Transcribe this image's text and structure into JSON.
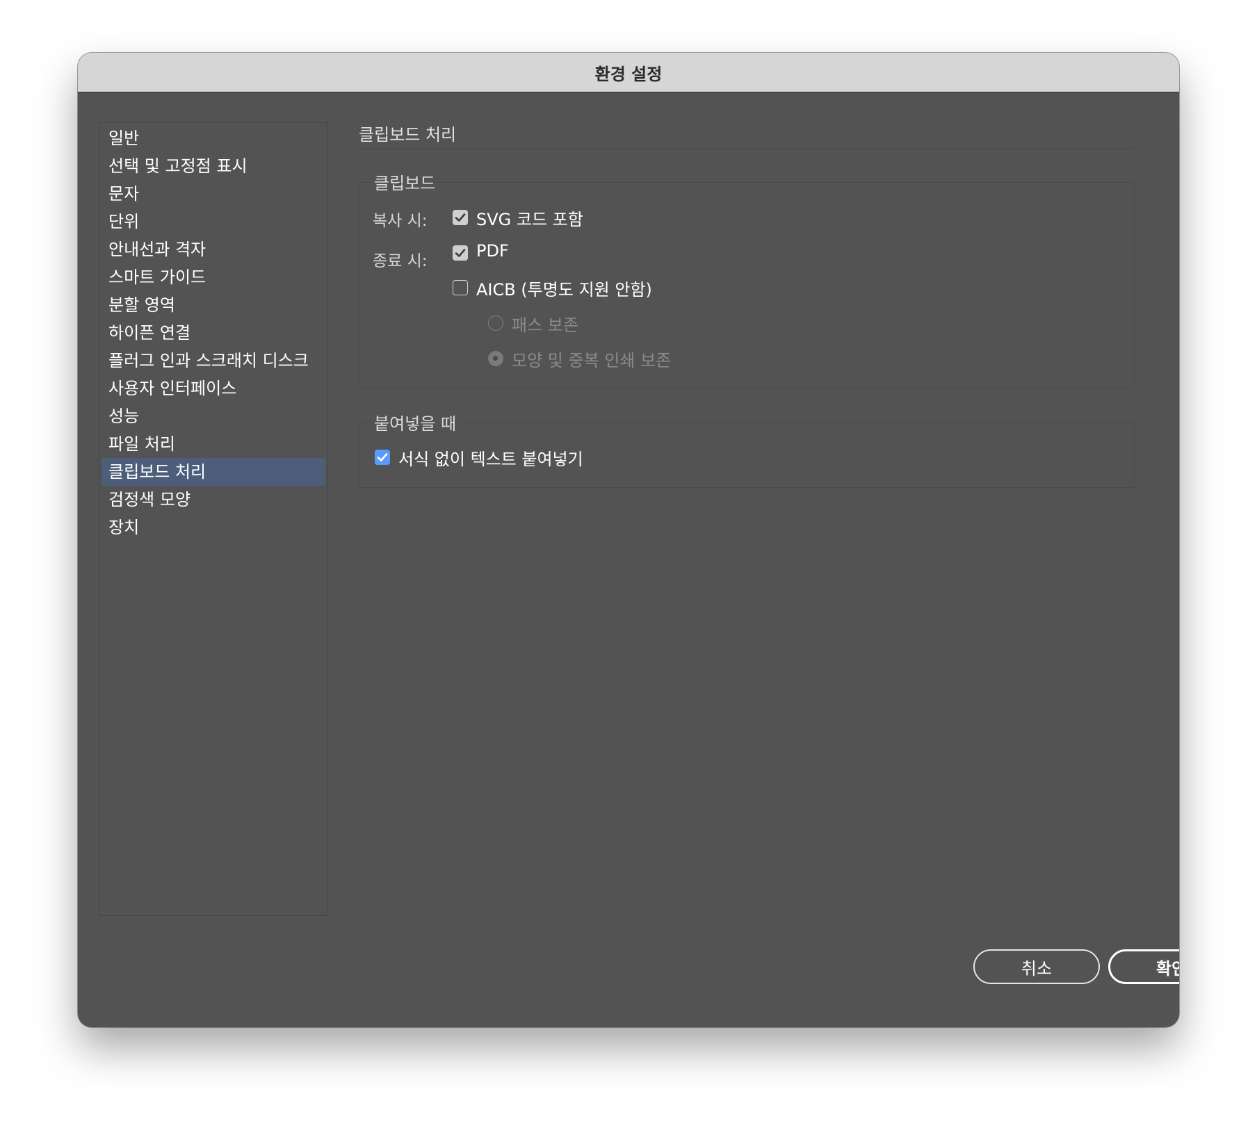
{
  "window": {
    "title": "환경 설정"
  },
  "sidebar": {
    "items": [
      {
        "label": "일반"
      },
      {
        "label": "선택 및 고정점 표시"
      },
      {
        "label": "문자"
      },
      {
        "label": "단위"
      },
      {
        "label": "안내선과 격자"
      },
      {
        "label": "스마트 가이드"
      },
      {
        "label": "분할 영역"
      },
      {
        "label": "하이픈 연결"
      },
      {
        "label": "플러그 인과 스크래치 디스크"
      },
      {
        "label": "사용자 인터페이스"
      },
      {
        "label": "성능"
      },
      {
        "label": "파일 처리"
      },
      {
        "label": "클립보드 처리"
      },
      {
        "label": "검정색 모양"
      },
      {
        "label": "장치"
      }
    ],
    "selected_index": 12
  },
  "panel": {
    "title": "클립보드 처리",
    "clipboard_group": {
      "label": "클립보드",
      "on_copy_label": "복사 시:",
      "svg_code_label": "SVG 코드 포함",
      "svg_code_checked": true,
      "on_quit_label": "종료 시:",
      "pdf_label": "PDF",
      "pdf_checked": true,
      "aicb_label": "AICB (투명도 지원 안함)",
      "aicb_checked": false,
      "preserve_paths_label": "패스 보존",
      "preserve_paths_selected": false,
      "preserve_appearance_label": "모양 및 중복 인쇄 보존",
      "preserve_appearance_selected": true
    },
    "paste_group": {
      "label": "붙여넣을 때",
      "paste_without_formatting_label": "서식 없이 텍스트 붙여넣기",
      "paste_without_formatting_checked": true
    }
  },
  "buttons": {
    "cancel_label": "취소",
    "ok_label": "확인"
  },
  "colors": {
    "window_bg": "#535353",
    "titlebar_bg": "#d6d6d6",
    "selection_bg": "#4d5e7a",
    "accent_checkbox": "#5a9bff"
  }
}
